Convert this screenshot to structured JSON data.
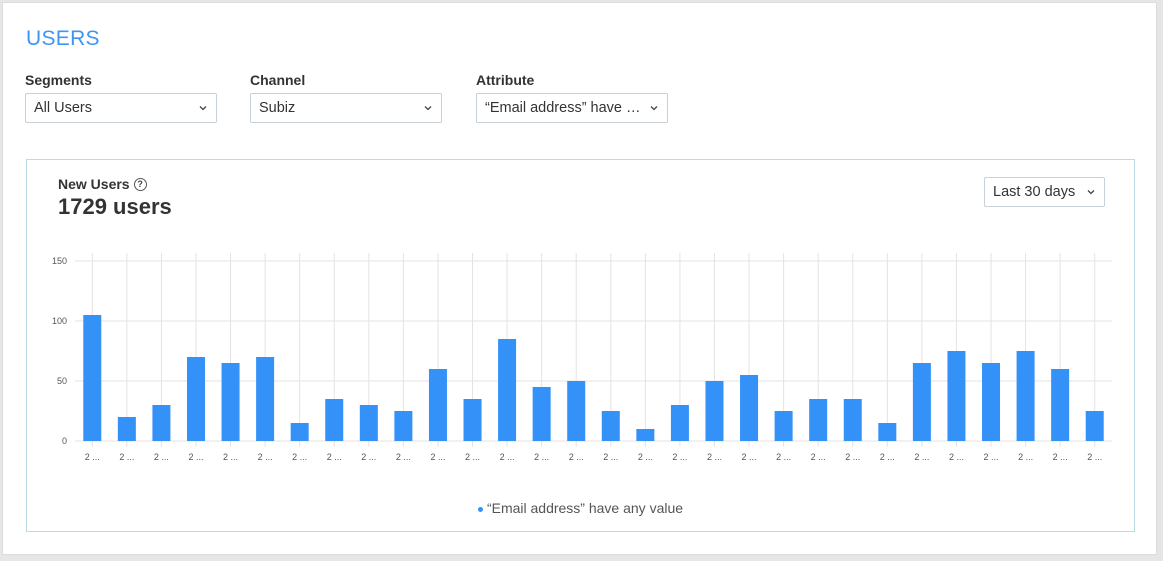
{
  "page": {
    "title": "USERS"
  },
  "filters": [
    {
      "label": "Segments",
      "value": "All Users"
    },
    {
      "label": "Channel",
      "value": "Subiz"
    },
    {
      "label": "Attribute",
      "value": "“Email address” have an..."
    }
  ],
  "card": {
    "title": "New Users",
    "help_icon": "question-circle-icon",
    "value": "1729 users",
    "range": "Last 30 days"
  },
  "colors": {
    "accent": "#3d95f4",
    "bar": "#3391f7",
    "grid": "#e3e3e3"
  },
  "chart_data": {
    "type": "bar",
    "categories": [
      "2 ...",
      "2 ...",
      "2 ...",
      "2 ...",
      "2 ...",
      "2 ...",
      "2 ...",
      "2 ...",
      "2 ...",
      "2 ...",
      "2 ...",
      "2 ...",
      "2 ...",
      "2 ...",
      "2 ...",
      "2 ...",
      "2 ...",
      "2 ...",
      "2 ...",
      "2 ...",
      "2 ...",
      "2 ...",
      "2 ...",
      "2 ...",
      "2 ...",
      "2 ...",
      "2 ...",
      "2 ...",
      "2 ...",
      "2 ..."
    ],
    "series": [
      {
        "name": "“Email address” have any value",
        "values": [
          105,
          20,
          30,
          70,
          65,
          70,
          15,
          35,
          30,
          25,
          60,
          35,
          85,
          45,
          50,
          25,
          10,
          30,
          50,
          55,
          25,
          35,
          35,
          15,
          65,
          75,
          65,
          75,
          60,
          25
        ]
      }
    ],
    "ylim": [
      0,
      150
    ],
    "yticks": [
      "0",
      "50",
      "100",
      "150"
    ],
    "ytick_values": [
      0,
      50,
      100,
      150
    ],
    "grid": true,
    "legend": "bottom-center"
  }
}
